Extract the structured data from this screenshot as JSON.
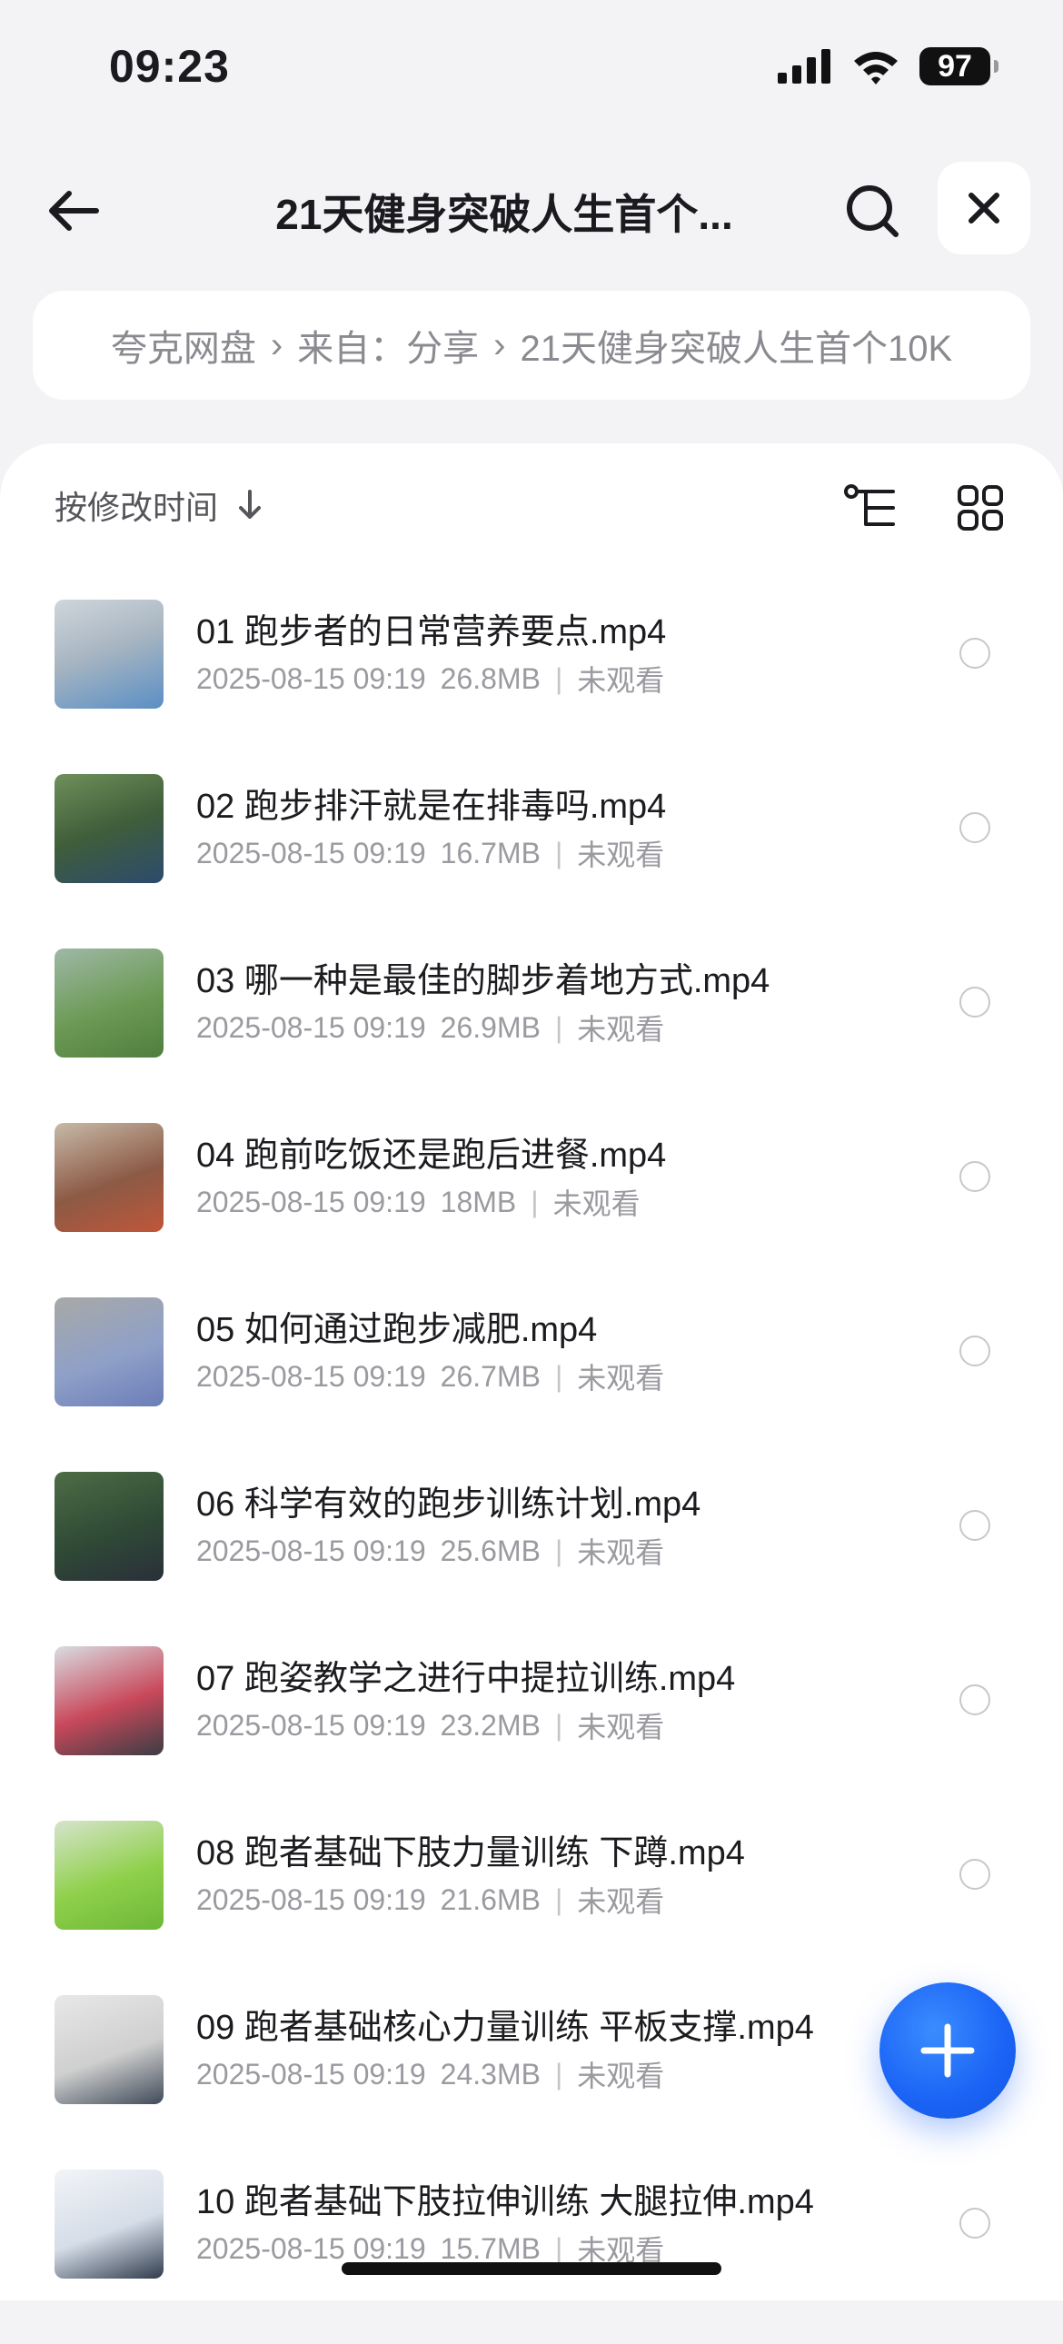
{
  "status_bar": {
    "time": "09:23",
    "battery": "97",
    "icons": [
      "signal-icon",
      "wifi-icon",
      "battery-icon"
    ]
  },
  "nav": {
    "title": "21天健身突破人生首个...",
    "back_icon": "arrow-left-icon",
    "search_icon": "search-icon",
    "close_icon": "close-icon"
  },
  "breadcrumb": {
    "items": [
      "夸克网盘",
      "来自：分享",
      "21天健身突破人生首个10K"
    ],
    "separator": "›"
  },
  "toolbar": {
    "sort_label": "按修改时间",
    "sort_icon": "arrow-down-icon",
    "tree_view_icon": "tree-view-icon",
    "grid_view_icon": "grid-view-icon"
  },
  "files": [
    {
      "name": "01 跑步者的日常营养要点.mp4",
      "date": "2025-08-15 09:19",
      "size": "26.8MB",
      "status": "未观看"
    },
    {
      "name": "02 跑步排汗就是在排毒吗.mp4",
      "date": "2025-08-15 09:19",
      "size": "16.7MB",
      "status": "未观看"
    },
    {
      "name": "03 哪一种是最佳的脚步着地方式.mp4",
      "date": "2025-08-15 09:19",
      "size": "26.9MB",
      "status": "未观看"
    },
    {
      "name": "04 跑前吃饭还是跑后进餐.mp4",
      "date": "2025-08-15 09:19",
      "size": "18MB",
      "status": "未观看"
    },
    {
      "name": "05 如何通过跑步减肥.mp4",
      "date": "2025-08-15 09:19",
      "size": "26.7MB",
      "status": "未观看"
    },
    {
      "name": "06 科学有效的跑步训练计划.mp4",
      "date": "2025-08-15 09:19",
      "size": "25.6MB",
      "status": "未观看"
    },
    {
      "name": "07 跑姿教学之进行中提拉训练.mp4",
      "date": "2025-08-15 09:19",
      "size": "23.2MB",
      "status": "未观看"
    },
    {
      "name": "08 跑者基础下肢力量训练 下蹲.mp4",
      "date": "2025-08-15 09:19",
      "size": "21.6MB",
      "status": "未观看"
    },
    {
      "name": "09 跑者基础核心力量训练 平板支撑.mp4",
      "date": "2025-08-15 09:19",
      "size": "24.3MB",
      "status": "未观看"
    },
    {
      "name": "10 跑者基础下肢拉伸训练 大腿拉伸.mp4",
      "date": "2025-08-15 09:19",
      "size": "15.7MB",
      "status": "未观看"
    }
  ],
  "fab_icon": "plus-icon",
  "colors": {
    "accent": "#1a63f5",
    "background": "#f3f3f5",
    "panel": "#ffffff",
    "meta_text": "#9a9aa0"
  }
}
